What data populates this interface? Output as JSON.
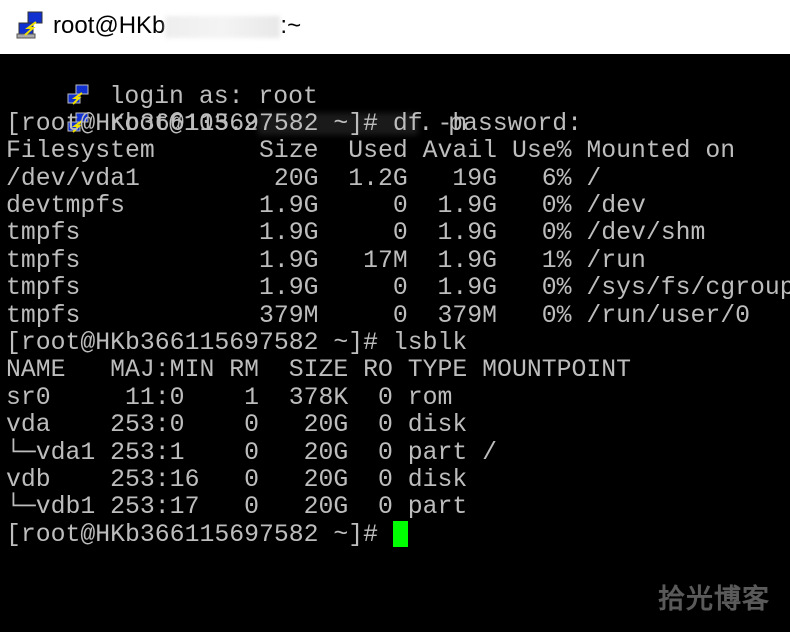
{
  "window": {
    "title_prefix": "root@HKb",
    "title_suffix": ":~",
    "icon": "putty-icon"
  },
  "terminal": {
    "login_line": "login as: root",
    "password_prefix": "root@103.2",
    "password_suffix": ". password:",
    "lines": [
      "[root@HKb366115697582 ~]# df -h",
      "Filesystem       Size  Used Avail Use% Mounted on",
      "/dev/vda1         20G  1.2G   19G   6% /",
      "devtmpfs         1.9G     0  1.9G   0% /dev",
      "tmpfs            1.9G     0  1.9G   0% /dev/shm",
      "tmpfs            1.9G   17M  1.9G   1% /run",
      "tmpfs            1.9G     0  1.9G   0% /sys/fs/cgroup",
      "tmpfs            379M     0  379M   0% /run/user/0",
      "[root@HKb366115697582 ~]# lsblk",
      "NAME   MAJ:MIN RM  SIZE RO TYPE MOUNTPOINT",
      "sr0     11:0    1  378K  0 rom",
      "vda    253:0    0   20G  0 disk",
      "└─vda1 253:1    0   20G  0 part /",
      "vdb    253:16   0   20G  0 disk",
      "└─vdb1 253:17   0   20G  0 part"
    ],
    "prompt": "[root@HKb366115697582 ~]# ",
    "cursor_color": "#00ff00",
    "text_color": "#bdbdbd"
  },
  "watermark": "拾光博客"
}
